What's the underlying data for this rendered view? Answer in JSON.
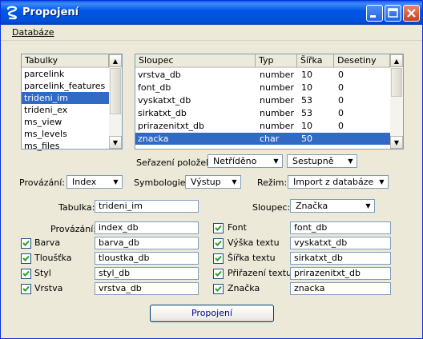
{
  "window": {
    "title": "Propojení",
    "menu": [
      "Databáze"
    ]
  },
  "tables": {
    "header": "Tabulky",
    "items": [
      "parcelink",
      "parcelink_features",
      "trideni_im",
      "trideni_ex",
      "ms_view",
      "ms_levels",
      "ms_files"
    ],
    "selected_index": 2
  },
  "columns": {
    "headers": [
      "Sloupec",
      "Typ",
      "Šířka",
      "Desetiny"
    ],
    "rows": [
      [
        "vrstva_db",
        "number",
        "10",
        "0"
      ],
      [
        "font_db",
        "number",
        "10",
        "0"
      ],
      [
        "vyskatxt_db",
        "number",
        "53",
        "0"
      ],
      [
        "sirkatxt_db",
        "number",
        "53",
        "0"
      ],
      [
        "prirazenitxt_db",
        "number",
        "10",
        "0"
      ],
      [
        "znacka",
        "char",
        "50",
        ""
      ]
    ],
    "selected_index": 5
  },
  "sort": {
    "label": "Seřazení položek:",
    "order_value": "Netříděno",
    "direction_value": "Sestupně"
  },
  "options": {
    "provazani_label": "Provázání:",
    "provazani_value": "Index",
    "symbologie_label": "Symbologie:",
    "symbologie_value": "Výstup",
    "rezim_label": "Režim:",
    "rezim_value": "Import z databáze"
  },
  "form": {
    "tabulka_label": "Tabulka:",
    "tabulka_value": "trideni_im",
    "sloupec_label": "Sloupec:",
    "sloupec_value": "Značka",
    "provazani_label": "Provázání:",
    "provazani_value": "index_db",
    "left_fields": [
      {
        "label": "Barva",
        "value": "barva_db",
        "checked": true
      },
      {
        "label": "Tloušťka",
        "value": "tloustka_db",
        "checked": true
      },
      {
        "label": "Styl",
        "value": "styl_db",
        "checked": true
      },
      {
        "label": "Vrstva",
        "value": "vrstva_db",
        "checked": true
      }
    ],
    "right_fields": [
      {
        "label": "Font",
        "value": "font_db",
        "checked": true
      },
      {
        "label": "Výška textu",
        "value": "vyskatxt_db",
        "checked": true
      },
      {
        "label": "Šířka textu",
        "value": "sirkatxt_db",
        "checked": true
      },
      {
        "label": "Přiřazení textu",
        "value": "prirazenitxt_db",
        "checked": true
      },
      {
        "label": "Značka",
        "value": "znacka",
        "checked": true
      }
    ]
  },
  "actions": {
    "connect_label": "Propojení"
  },
  "colors": {
    "selection": "#316ac5",
    "titlebar": "#0058e6",
    "face": "#ece9d8"
  }
}
